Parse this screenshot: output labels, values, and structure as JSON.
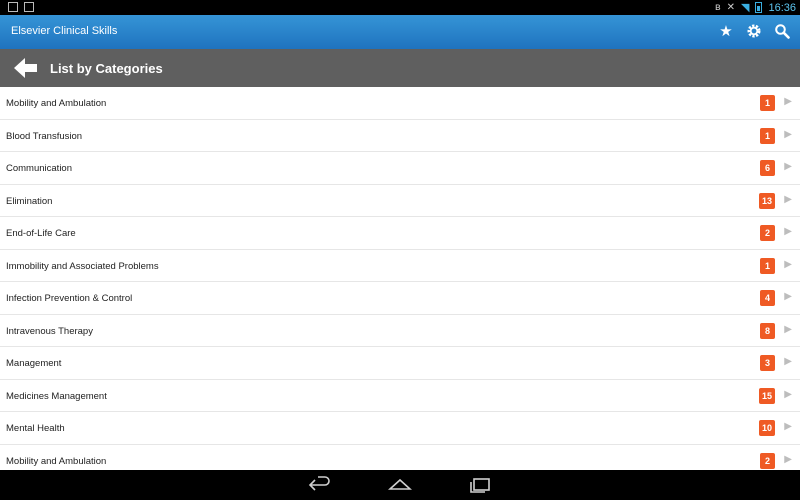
{
  "status": {
    "time": "16:36"
  },
  "app": {
    "title": "Elsevier Clinical Skills"
  },
  "header": {
    "title": "List by Categories"
  },
  "categories": [
    {
      "label": "Mobility and Ambulation",
      "count": "1"
    },
    {
      "label": "Blood Transfusion",
      "count": "1"
    },
    {
      "label": "Communication",
      "count": "6"
    },
    {
      "label": "Elimination",
      "count": "13"
    },
    {
      "label": "End-of-Life Care",
      "count": "2"
    },
    {
      "label": "Immobility and Associated Problems",
      "count": "1"
    },
    {
      "label": "Infection Prevention & Control",
      "count": "4"
    },
    {
      "label": "Intravenous Therapy",
      "count": "8"
    },
    {
      "label": "Management",
      "count": "3"
    },
    {
      "label": "Medicines Management",
      "count": "15"
    },
    {
      "label": "Mental Health",
      "count": "10"
    },
    {
      "label": "Mobility and Ambulation",
      "count": "2"
    }
  ],
  "icons": {
    "appbar": [
      "star-icon",
      "gear-icon",
      "search-icon"
    ],
    "navbar": [
      "back-nav-icon",
      "home-nav-icon",
      "recents-nav-icon"
    ]
  },
  "colors": {
    "appbar": "#2a86cf",
    "header": "#5f5f5f",
    "badge": "#ef5a24"
  }
}
